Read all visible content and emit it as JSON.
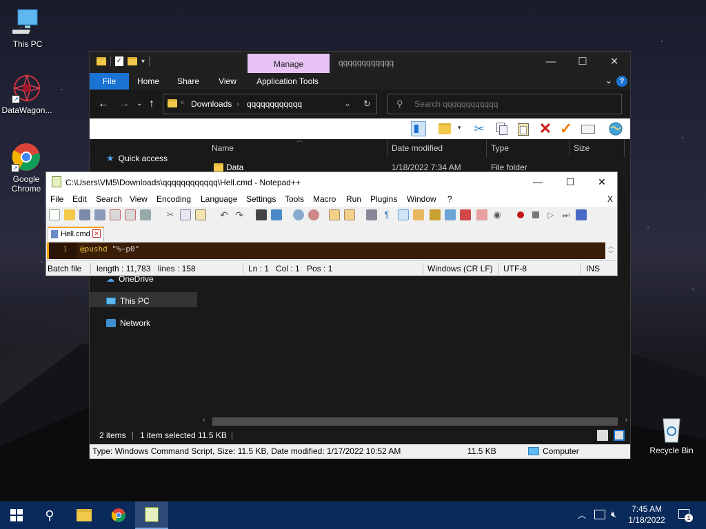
{
  "desktop": {
    "icons": [
      {
        "label": "This PC"
      },
      {
        "label": "DataWagon..."
      },
      {
        "label": "Google Chrome"
      },
      {
        "label": "Recycle Bin"
      }
    ]
  },
  "explorer": {
    "context_tab": "Manage",
    "title": "qqqqqqqqqqqq",
    "ribbon_tabs": [
      "File",
      "Home",
      "Share",
      "View",
      "Application Tools"
    ],
    "address": {
      "crumbs": [
        "Downloads",
        "qqqqqqqqqqqq"
      ]
    },
    "search_placeholder": "Search qqqqqqqqqqqq",
    "nav_pane": {
      "quick_access": "Quick access",
      "onedrive": "OneDrive",
      "this_pc": "This PC",
      "network": "Network"
    },
    "columns": {
      "name": "Name",
      "date_modified": "Date modified",
      "type": "Type",
      "size": "Size"
    },
    "files": [
      {
        "name": "Data",
        "date": "1/18/2022 7:34 AM",
        "type": "File folder",
        "size": ""
      }
    ],
    "status": {
      "items": "2 items",
      "selected": "1 item selected  11.5 KB"
    },
    "infobar": {
      "details": "Type: Windows Command Script, Size: 11.5 KB, Date modified: 1/17/2022 10:52 AM",
      "size": "11.5 KB",
      "location": "Computer"
    }
  },
  "notepad": {
    "title": "C:\\Users\\VM5\\Downloads\\qqqqqqqqqqqq\\Hell.cmd - Notepad++",
    "menu": [
      "File",
      "Edit",
      "Search",
      "View",
      "Encoding",
      "Language",
      "Settings",
      "Tools",
      "Macro",
      "Run",
      "Plugins",
      "Window",
      "?"
    ],
    "close_doc": "X",
    "tab": "Hell.cmd",
    "line_number": "1",
    "code": {
      "keyword": "@pushd",
      "string": "\"%~p0\""
    },
    "status": {
      "lang": "Batch file",
      "length": "length : 11,783",
      "lines": "lines : 158",
      "ln": "Ln : 1",
      "col": "Col : 1",
      "pos": "Pos : 1",
      "eol": "Windows (CR LF)",
      "encoding": "UTF-8",
      "mode": "INS"
    }
  },
  "taskbar": {
    "time": "7:45 AM",
    "date": "1/18/2022",
    "notification_count": "1"
  },
  "colors": {
    "explorer_bg": "#191919",
    "file_tab": "#1a73d3",
    "manage_tab": "#e7c2f5",
    "taskbar": "#0a2a5c",
    "npp_editor_bg": "#3b1e08",
    "npp_keyword": "#e6c43a",
    "npp_string": "#d0d0d0"
  }
}
